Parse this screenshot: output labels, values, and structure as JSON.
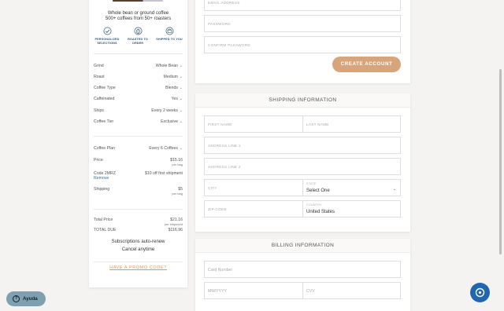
{
  "summary": {
    "tagline_1": "Whole bean or ground coffee",
    "tagline_2": "500+ coffees from 50+ roasters",
    "perks": [
      {
        "label_1": "PERSONALIZED",
        "label_2": "SELECTIONS",
        "icon": "checkmark-badge-icon"
      },
      {
        "label_1": "ROASTED TO",
        "label_2": "ORDER",
        "icon": "coffee-bean-badge-icon"
      },
      {
        "label_1": "SHIPPED TO YOU",
        "label_2": "",
        "icon": "package-badge-icon"
      }
    ],
    "options": [
      {
        "key": "Grind",
        "value": "Whole Bean"
      },
      {
        "key": "Roast",
        "value": "Medium"
      },
      {
        "key": "Coffee Type",
        "value": "Blends"
      },
      {
        "key": "Caffeinated",
        "value": "Yes"
      },
      {
        "key": "Ships",
        "value": "Every 2 weeks"
      },
      {
        "key": "Coffee Tier",
        "value": "Exclusive"
      }
    ],
    "plan": {
      "key": "Coffee Plan",
      "value": "Every 6 Coffees"
    },
    "price": {
      "key": "Price",
      "value": "$15.16",
      "sub": "per bag"
    },
    "code": {
      "key": "Code 2MRZ",
      "value": "$10 off first shipment",
      "remove": "Remove"
    },
    "shipping": {
      "key": "Shipping",
      "value": "$5",
      "sub": "per bag"
    },
    "total_price": {
      "key": "Total Price",
      "value": "$21.16",
      "sub": "per shipment"
    },
    "total_due": {
      "key": "TOTAL DUE",
      "value": "$116.96"
    },
    "auto_renew": "Subscriptions auto-renew",
    "cancel": "Cancel anytime",
    "promo": "HAVE A PROMO CODE?"
  },
  "account": {
    "email_placeholder": "EMAIL ADDRESS",
    "password_placeholder": "PASSWORD",
    "confirm_placeholder": "CONFIRM PASSWORD",
    "create_button": "CREATE ACCOUNT"
  },
  "shipping": {
    "title": "SHIPPING INFORMATION",
    "first_name": "FIRST NAME",
    "last_name": "LAST NAME",
    "address1": "ADDRESS LINE 1",
    "address2": "ADDRESS LINE 2",
    "city": "CITY",
    "state_label": "STATE",
    "state_value": "Select One",
    "zip": "ZIP CODE",
    "country_label": "COUNTRY",
    "country_value": "United States"
  },
  "billing": {
    "title": "BILLING INFORMATION",
    "card_number": "Card Number",
    "expiry": "MM/YYYY",
    "cvv": "CVV"
  },
  "widgets": {
    "help_label": "Ayuda"
  },
  "colors": {
    "accent": "#d7a57c",
    "link": "#2d6fb0",
    "chat": "#1f68b1",
    "help": "#7fa0b0"
  }
}
